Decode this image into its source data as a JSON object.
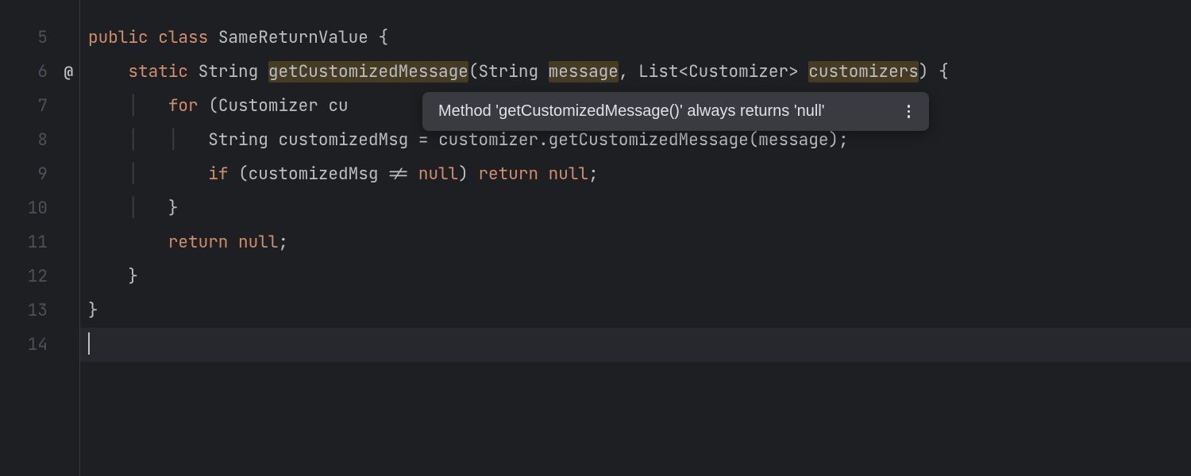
{
  "gutter": {
    "lines": [
      "5",
      "6",
      "7",
      "8",
      "9",
      "10",
      "11",
      "12",
      "13",
      "14"
    ],
    "annotationLine": 6,
    "annotationGlyph": "@"
  },
  "code": {
    "line5": {
      "kw1": "public",
      "kw2": "class",
      "className": "SameReturnValue",
      "brace": "{"
    },
    "line6": {
      "kw1": "static",
      "type": "String",
      "method": "getCustomizedMessage",
      "open": "(",
      "p1type": "String",
      "p1name": "message",
      "comma": ", ",
      "p2type": "List<Customizer>",
      "p2name": "customizers",
      "close": ")",
      "brace": "{"
    },
    "line7": {
      "kw": "for",
      "open": " (",
      "type": "Customizer",
      "var": "cu"
    },
    "line8": {
      "pre": "            String customizedMsg = customizer.getCustomizedMessage(message);"
    },
    "line9": {
      "kw1": "if",
      "open": " (",
      "var": "customizedMsg",
      "op": " != ",
      "kw2": "null",
      "close": ") ",
      "kw3": "return",
      "sp": " ",
      "kw4": "null",
      "semi": ";"
    },
    "line10": {
      "brace": "}"
    },
    "line11": {
      "kw": "return",
      "sp": " ",
      "val": "null",
      "semi": ";"
    },
    "line12": {
      "brace": "}"
    },
    "line13": {
      "brace": "}"
    }
  },
  "tooltip": {
    "text": "Method 'getCustomizedMessage()' always returns 'null'"
  }
}
